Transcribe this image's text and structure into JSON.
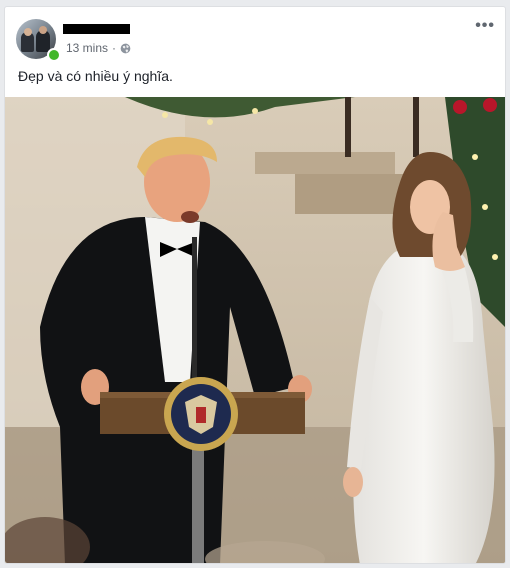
{
  "post": {
    "author": "██████████",
    "time": "13 mins",
    "separator": "·",
    "text": "Đẹp và có nhiều ý nghĩa.",
    "more_label": "•••",
    "privacy_icon": "globe-icon",
    "photo_description": "photo-of-event"
  },
  "colors": {
    "online": "#42b72a",
    "meta_text": "#616770"
  }
}
